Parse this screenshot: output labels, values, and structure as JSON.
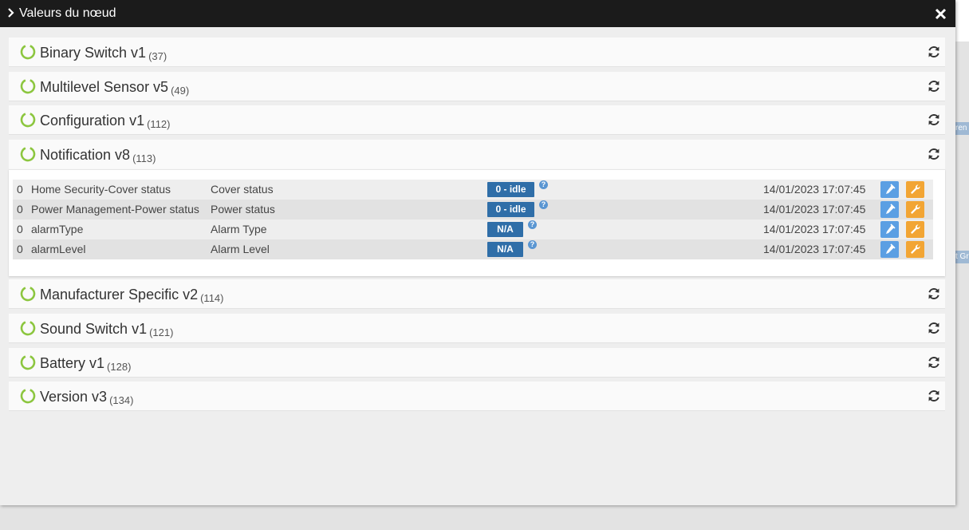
{
  "modal": {
    "title": "Valeurs du nœud"
  },
  "background": {
    "tag1": "ren",
    "tag2": "t Gr"
  },
  "panels": [
    {
      "name": "Binary Switch v1",
      "count": "(37)"
    },
    {
      "name": "Multilevel Sensor v5",
      "count": "(49)"
    },
    {
      "name": "Configuration v1",
      "count": "(112)"
    },
    {
      "name": "Notification v8",
      "count": "(113)"
    },
    {
      "name": "Manufacturer Specific v2",
      "count": "(114)"
    },
    {
      "name": "Sound Switch v1",
      "count": "(121)"
    },
    {
      "name": "Battery v1",
      "count": "(128)"
    },
    {
      "name": "Version v3",
      "count": "(134)"
    }
  ],
  "notification_rows": [
    {
      "instance": "0",
      "name": "Home Security-Cover status",
      "label": "Cover status",
      "value": "0 - idle",
      "help": "?",
      "time": "14/01/2023 17:07:45"
    },
    {
      "instance": "0",
      "name": "Power Management-Power status",
      "label": "Power status",
      "value": "0 - idle",
      "help": "?",
      "time": "14/01/2023 17:07:45"
    },
    {
      "instance": "0",
      "name": "alarmType",
      "label": "Alarm Type",
      "value": "N/A",
      "help": "?",
      "time": "14/01/2023 17:07:45"
    },
    {
      "instance": "0",
      "name": "alarmLevel",
      "label": "Alarm Level",
      "value": "N/A",
      "help": "?",
      "time": "14/01/2023 17:07:45"
    }
  ],
  "icons": {
    "expand": "chevron-right-icon",
    "close": "close-icon",
    "status": "status-ring-icon",
    "refresh": "refresh-icon",
    "flask": "eyedropper-icon",
    "wrench": "wrench-icon"
  },
  "colors": {
    "header": "#1b1b1b",
    "ring": "#8cc63f",
    "badge": "#2f6ea8",
    "btn_blue": "#5b9fe3",
    "btn_orange": "#f2a534"
  }
}
